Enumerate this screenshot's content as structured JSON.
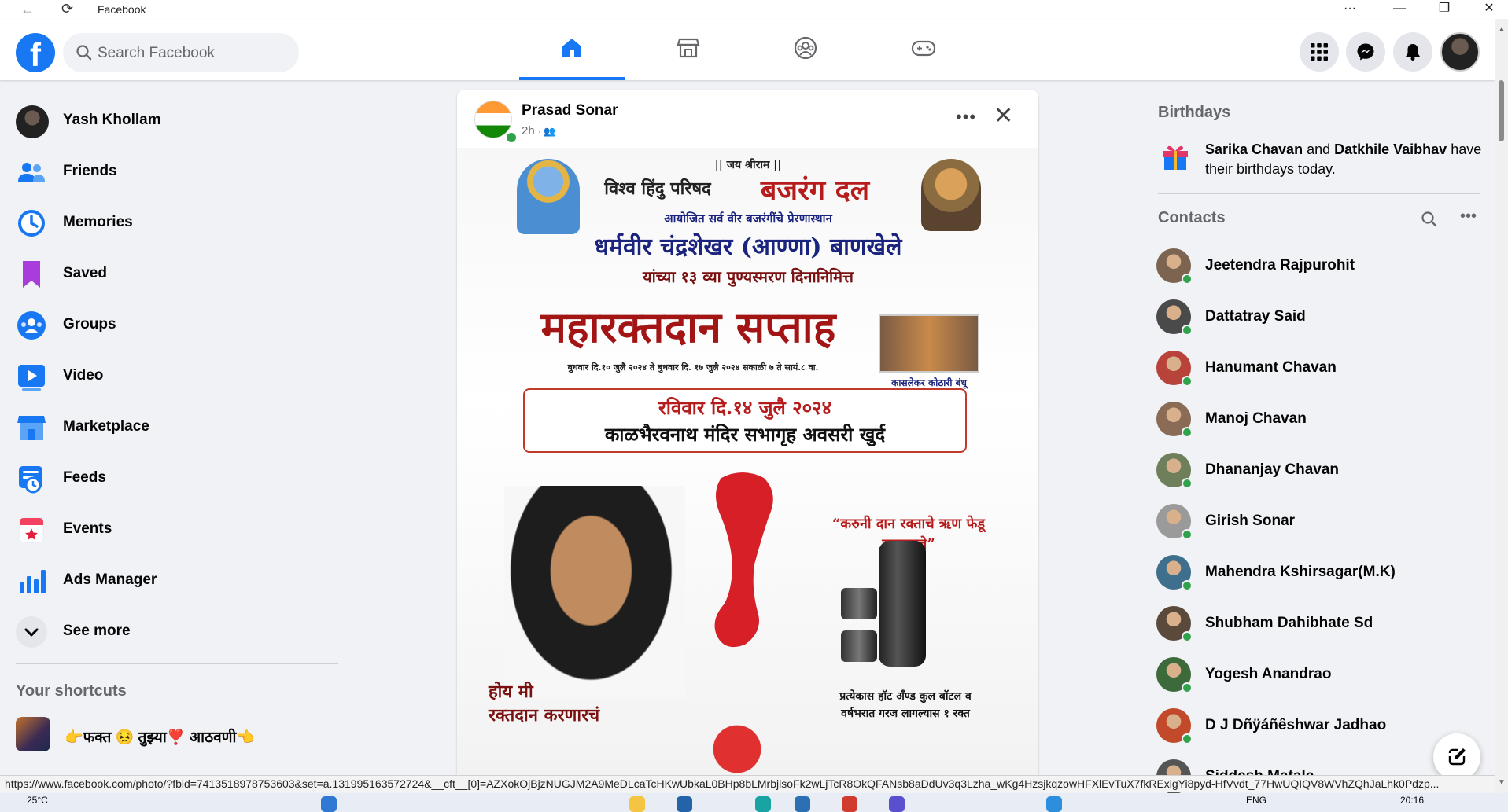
{
  "window": {
    "title": "Facebook",
    "controls": {
      "more": "···",
      "minimize": "—",
      "restore": "❐",
      "close": "✕"
    }
  },
  "header": {
    "search_placeholder": "Search Facebook",
    "tabs": [
      {
        "name": "home-icon",
        "active": true
      },
      {
        "name": "marketplace-icon",
        "active": false
      },
      {
        "name": "groups-icon",
        "active": false
      },
      {
        "name": "gaming-icon",
        "active": false
      }
    ],
    "accent": "#1877f2"
  },
  "sidebar": {
    "profile_name": "Yash Khollam",
    "items": [
      {
        "label": "Friends",
        "icon": "friends-icon"
      },
      {
        "label": "Memories",
        "icon": "memories-icon"
      },
      {
        "label": "Saved",
        "icon": "saved-icon"
      },
      {
        "label": "Groups",
        "icon": "groups-icon"
      },
      {
        "label": "Video",
        "icon": "video-icon"
      },
      {
        "label": "Marketplace",
        "icon": "marketplace-icon"
      },
      {
        "label": "Feeds",
        "icon": "feeds-icon"
      },
      {
        "label": "Events",
        "icon": "events-icon"
      },
      {
        "label": "Ads Manager",
        "icon": "ads-manager-icon"
      },
      {
        "label": "See more",
        "icon": "chevron-down-icon"
      }
    ],
    "shortcuts_title": "Your shortcuts",
    "shortcut_label": "👉फक्त 😣 तुझ्या❣️ आठवणी👈"
  },
  "post": {
    "author": "Prasad Sonar",
    "time": "2h",
    "poster": {
      "line1": "|| जय श्रीराम ||",
      "line2_a": "विश्व हिंदु परिषद",
      "line2_b": "बजरंग दल",
      "line3": "आयोजित सर्व वीर बजरंगींचे प्रेरणास्थान",
      "line4": "धर्मवीर चंद्रशेखर (आण्णा) बाणखेले",
      "line5": "यांच्या १३ व्या पुण्यस्मरण दिनानिमित्त",
      "headline": "महारक्तदान सप्ताह",
      "dates": "बुधवार दि.१० जुलै २०२४ ते बुधवार दि. १७ जुलै २०२४ सकाळी ७ ते सायं.८ वा.",
      "photo_caption": "कासलेकर कोठारी बंधू",
      "date_box_1": "रविवार दि.१४ जुलै २०२४",
      "date_box_2": "काळभैरवनाथ मंदिर सभागृह अवसरी खुर्द",
      "quote": "“करुनी दान रक्ताचे ऋण फेडू समाजाचे”",
      "left_bottom_1": "होय मी",
      "left_bottom_2": "रक्तदान करणारचं",
      "right_bottom_1": "प्रत्येकास हॉट अँण्ड कुल बॉटल व",
      "right_bottom_2": "वर्षभरात गरज लागल्यास १ रक्त"
    }
  },
  "right": {
    "birthdays_title": "Birthdays",
    "bday_name1": "Sarika Chavan",
    "bday_and": " and ",
    "bday_name2": "Datkhile Vaibhav",
    "bday_rest": " have their birthdays today.",
    "contacts_title": "Contacts",
    "contacts": [
      {
        "name": "Jeetendra Rajpurohit",
        "color": "#7d6450"
      },
      {
        "name": "Dattatray Said",
        "color": "#4a4a4a"
      },
      {
        "name": "Hanumant Chavan",
        "color": "#b8433a"
      },
      {
        "name": "Manoj Chavan",
        "color": "#8a6b55"
      },
      {
        "name": "Dhananjay Chavan",
        "color": "#6f7f5c"
      },
      {
        "name": "Girish Sonar",
        "color": "#9a9a9a"
      },
      {
        "name": "Mahendra Kshirsagar(M.K)",
        "color": "#3e6f8c"
      },
      {
        "name": "Shubham Dahibhate Sd",
        "color": "#5b4a3c"
      },
      {
        "name": "Yogesh Anandrao",
        "color": "#3c6a3a"
      },
      {
        "name": "D J Dñÿáñêshwar Jadhao",
        "color": "#c24a2a"
      },
      {
        "name": "Siddesh Matale",
        "color": "#555555"
      }
    ]
  },
  "statusbar": {
    "url": "https://www.facebook.com/photo/?fbid=7413518978753603&set=a.131995163572724&__cft__[0]=AZXokOjBjzNUGJM2A9MeDLcaTcHKwUbkaL0BHp8bLMrbjlsoFk2wLjTcR8OkQFANsb8aDdUv3q3Lzha_wKg4HzsjkqzowHFXlEvTuX7fkRExigYi8pyd-HfVvdt_77HwUQIQV8WVhZQhJaLhk0Pdzp..."
  },
  "taskbar": {
    "weather": "25°C",
    "lang": "ENG",
    "time": "20:16"
  }
}
